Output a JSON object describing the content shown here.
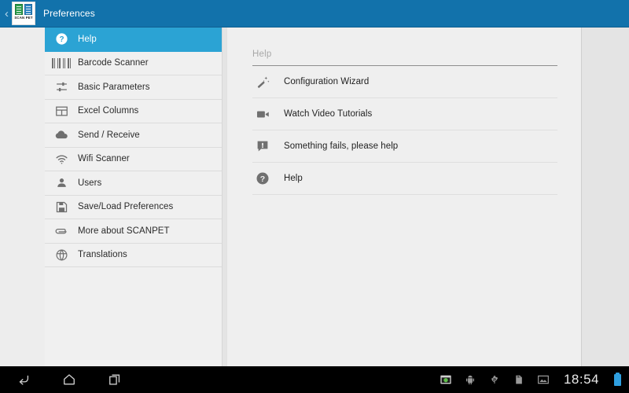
{
  "titlebar": {
    "up_caret": "‹",
    "app_name": "Preferences",
    "app_icon_label": "SCAN PET"
  },
  "sidebar": {
    "items": [
      {
        "label": "Help",
        "icon": "help-circle-icon",
        "selected": true
      },
      {
        "label": "Barcode Scanner",
        "icon": "barcode-icon",
        "selected": false
      },
      {
        "label": "Basic Parameters",
        "icon": "sliders-icon",
        "selected": false
      },
      {
        "label": "Excel Columns",
        "icon": "table-grid-icon",
        "selected": false
      },
      {
        "label": "Send / Receive",
        "icon": "cloud-icon",
        "selected": false
      },
      {
        "label": "Wifi Scanner",
        "icon": "wifi-icon",
        "selected": false
      },
      {
        "label": "Users",
        "icon": "person-icon",
        "selected": false
      },
      {
        "label": "Save/Load Preferences",
        "icon": "floppy-disk-icon",
        "selected": false
      },
      {
        "label": "More about SCANPET",
        "icon": "paperclip-icon",
        "selected": false
      },
      {
        "label": "Translations",
        "icon": "globe-icon",
        "selected": false
      }
    ]
  },
  "panel": {
    "header": "Help",
    "rows": [
      {
        "label": "Configuration Wizard",
        "icon": "magic-wand-icon"
      },
      {
        "label": "Watch Video Tutorials",
        "icon": "video-camera-icon"
      },
      {
        "label": "Something fails, please help",
        "icon": "speech-bubble-alert-icon"
      },
      {
        "label": "Help",
        "icon": "help-circle-icon"
      }
    ]
  },
  "navbar": {
    "back": "back-icon",
    "home": "home-icon",
    "recents": "recent-apps-icon",
    "tray": [
      {
        "icon": "scanpet-notification-icon"
      },
      {
        "icon": "android-robot-icon"
      },
      {
        "icon": "usb-icon"
      },
      {
        "icon": "sd-card-icon"
      },
      {
        "icon": "screenshot-image-icon"
      }
    ],
    "clock": "18:54",
    "battery": "battery-full-icon"
  },
  "colors": {
    "titlebar_blue": "#1272ab",
    "selection_blue": "#2ba3d4",
    "sidebar_bg": "#f0f0f0",
    "card_bg": "#efefef",
    "page_bg": "#e4e4e4",
    "navbar_bg": "#000000",
    "battery_blue": "#2f9fe0"
  }
}
